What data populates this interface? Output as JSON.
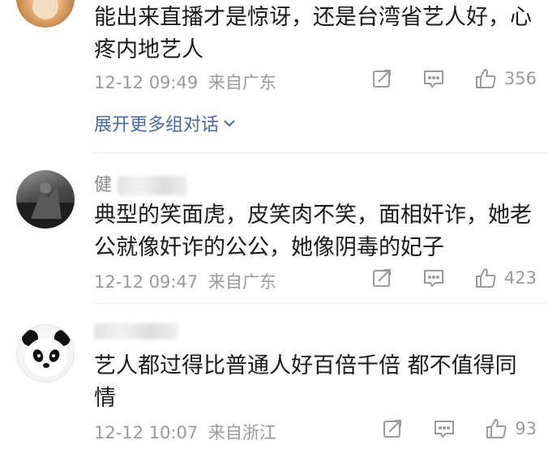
{
  "comments": [
    {
      "username": "",
      "text": "能出来直播才是惊讶，还是台湾省艺人好，心疼内地艺人",
      "time": "12-12 09:49",
      "location": "来自广东",
      "likes": "356",
      "expand_label": "展开更多组对话"
    },
    {
      "username": "健",
      "text": "典型的笑面虎，皮笑肉不笑，面相奸诈，她老公就像奸诈的公公，她像阴毒的妃子",
      "time": "12-12 09:47",
      "location": "来自广东",
      "likes": "423"
    },
    {
      "username": "",
      "text": "艺人都过得比普通人好百倍千倍 都不值得同情",
      "time": "12-12 10:07",
      "location": "来自浙江",
      "likes": "93"
    }
  ],
  "icons": {
    "share": "share-icon",
    "comment": "comment-icon",
    "like": "thumbs-up-icon",
    "expand": "chevron-down-icon"
  },
  "colors": {
    "text": "#1a1a1a",
    "meta": "#9a9a9a",
    "link": "#4a6aa0",
    "divider": "#ececec"
  }
}
